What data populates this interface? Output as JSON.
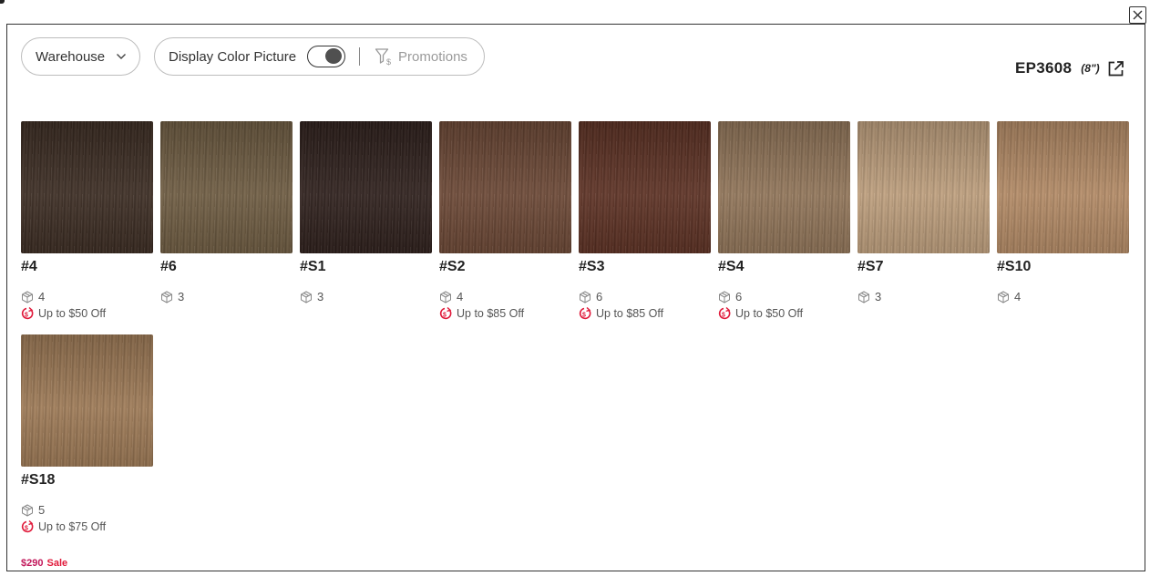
{
  "filters": {
    "warehouse_label": "Warehouse",
    "display_color_label": "Display Color Picture",
    "display_color_on": true,
    "promotions_label": "Promotions"
  },
  "product": {
    "code": "EP3608",
    "size": "(8\")"
  },
  "colors": {
    "accent_red": "#e0193a",
    "price_pink": "#c2185b",
    "muted_text": "#9a9a9a"
  },
  "swatches": [
    {
      "name": "#4",
      "stock": "4",
      "deal": "Up to $50 Off",
      "tone": "#3a2a20"
    },
    {
      "name": "#6",
      "stock": "3",
      "deal": "",
      "tone": "#6e5b40"
    },
    {
      "name": "#S1",
      "stock": "3",
      "deal": "",
      "tone": "#2c1d19"
    },
    {
      "name": "#S2",
      "stock": "4",
      "deal": "Up to $85 Off",
      "tone": "#6b4633"
    },
    {
      "name": "#S3",
      "stock": "6",
      "deal": "Up to $85 Off",
      "tone": "#5c2f21"
    },
    {
      "name": "#S4",
      "stock": "6",
      "deal": "Up to $50 Off",
      "tone": "#927558"
    },
    {
      "name": "#S7",
      "stock": "3",
      "deal": "",
      "tone": "#c0a07d"
    },
    {
      "name": "#S10",
      "stock": "4",
      "deal": "",
      "tone": "#b58b65"
    },
    {
      "name": "#S18",
      "stock": "5",
      "deal": "Up to $75 Off",
      "tone": "#9f7a55"
    }
  ],
  "price": {
    "amount": "$290",
    "label": "Sale"
  }
}
